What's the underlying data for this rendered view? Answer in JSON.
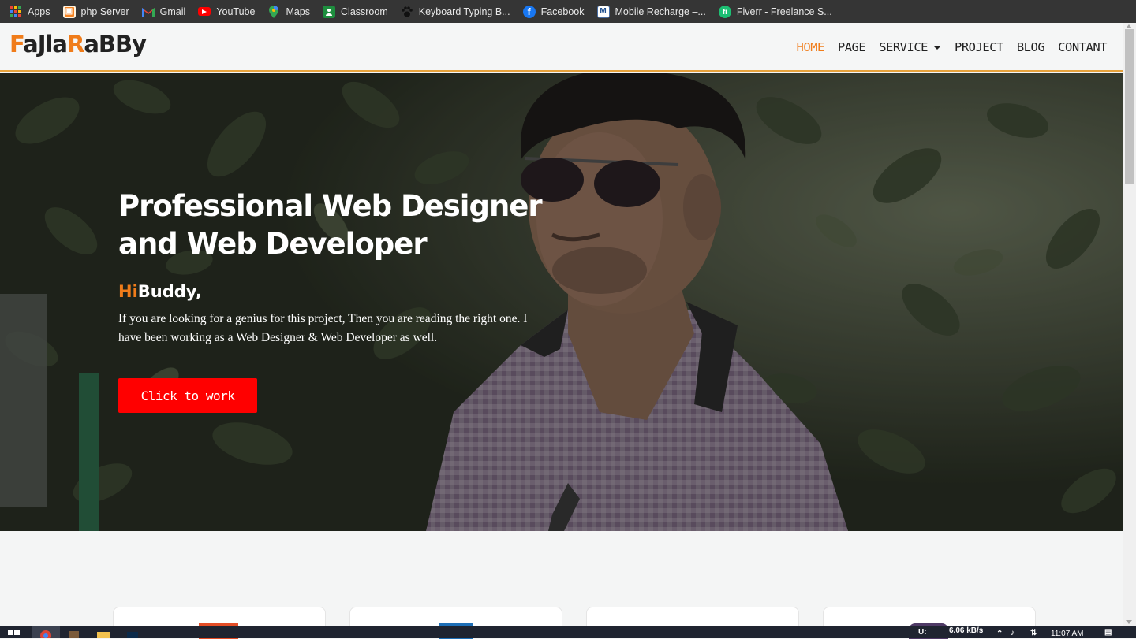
{
  "bookmarks": [
    {
      "label": "Apps",
      "icon": "apps-grid-icon"
    },
    {
      "label": "php Server",
      "icon": "php-server-icon"
    },
    {
      "label": "Gmail",
      "icon": "gmail-icon"
    },
    {
      "label": "YouTube",
      "icon": "youtube-icon"
    },
    {
      "label": "Maps",
      "icon": "maps-icon"
    },
    {
      "label": "Classroom",
      "icon": "classroom-icon"
    },
    {
      "label": "Keyboard Typing B...",
      "icon": "paw-icon"
    },
    {
      "label": "Facebook",
      "icon": "facebook-icon"
    },
    {
      "label": "Mobile Recharge –...",
      "icon": "mobile-recharge-icon"
    },
    {
      "label": "Fiverr - Freelance S...",
      "icon": "fiverr-icon"
    }
  ],
  "brand": {
    "logo_part1": "F",
    "logo_part2": "aJla",
    "logo_part3": "R",
    "logo_part4": "aBBy",
    "accent": "#f07c1a"
  },
  "nav": {
    "home": "HOME",
    "page": "PAGE",
    "service": "SERVICE",
    "project": "PROJECT",
    "blog": "BLOG",
    "contact": "CONTANT"
  },
  "hero": {
    "title": "Professional Web Designer and Web Developer",
    "greet_hi": "Hi",
    "greet_rest": "Buddy,",
    "text": "If you are looking for a genius for this project, Then you are reading the right one. I have been working as a Web Designer & Web Developer as well.",
    "cta_label": "Click to work",
    "cta_color": "#ff0000"
  },
  "taskbar": {
    "net_label": "U:",
    "net_speed": "6.06 kB/s",
    "time": "11:07 AM"
  }
}
